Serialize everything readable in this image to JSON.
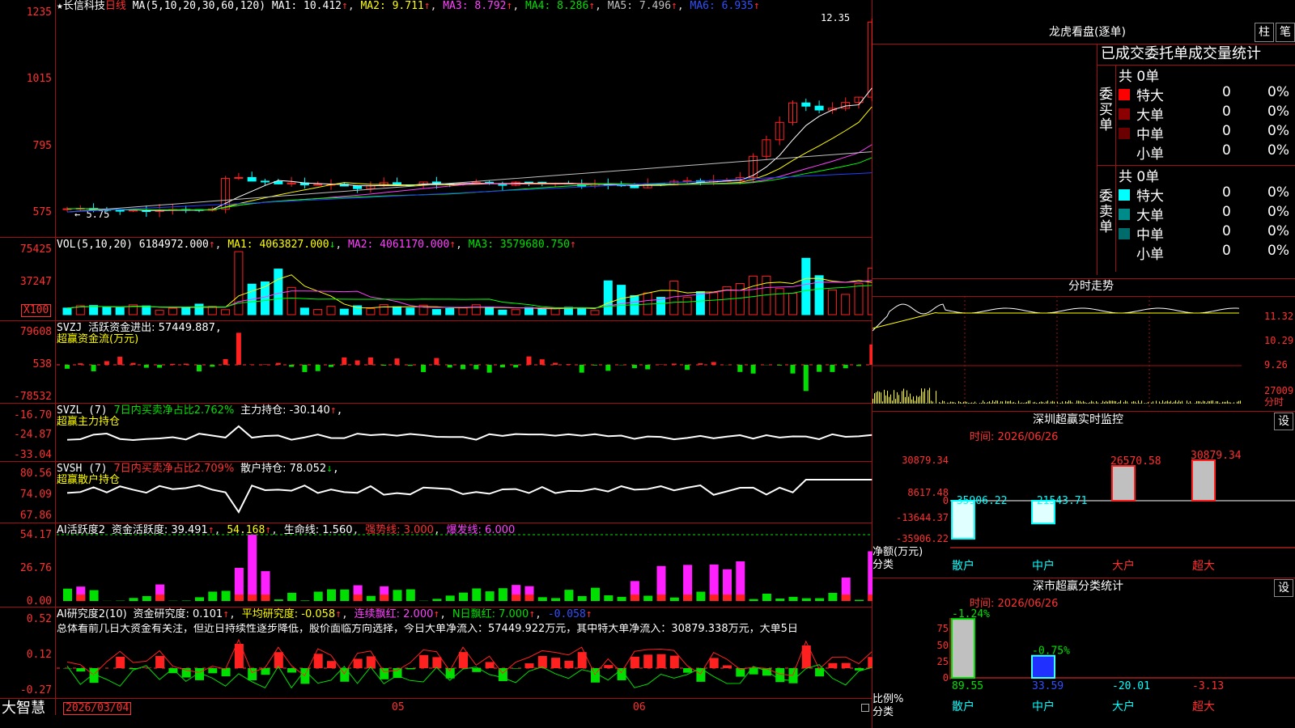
{
  "app_name": "大智慧",
  "stock": {
    "name": "长信科技",
    "period": "日线"
  },
  "colors": {
    "up": "#ff2020",
    "down": "#00ffff",
    "ma1": "#ffffff",
    "ma2": "#ffff00",
    "ma3": "#ff40ff",
    "ma4": "#00ff00",
    "ma5": "#c0c0c0",
    "ma6": "#2040ff"
  },
  "kline_panel": {
    "ma_label": "MA(5,10,20,30,60,120)",
    "ma1": "MA1: 10.412",
    "ma2": "MA2: 9.711",
    "ma3": "MA3: 8.792",
    "ma4": "MA4: 8.286",
    "ma5": "MA5: 7.496",
    "ma6": "MA6: 6.935",
    "y_ticks": [
      "1235",
      "1015",
      "795",
      "575"
    ],
    "high_label": "12.35",
    "low_label": "5.75"
  },
  "vol_panel": {
    "label": "VOL(5,10,20)",
    "value": "6184972.000",
    "ma1": "MA1: 4063827.000",
    "ma2": "MA2: 4061170.000",
    "ma3": "MA3: 3579680.750",
    "y_ticks": [
      "75425",
      "37247"
    ],
    "unit": "X100"
  },
  "svzj_panel": {
    "label": "SVZJ",
    "title": "活跃资金进出: 57449.887",
    "sub": "超赢资金流(万元)",
    "y_ticks": [
      "79608",
      "538",
      "-78532"
    ]
  },
  "svzl_panel": {
    "label": "SVZL (7)",
    "ratio": "7日内买卖净占比2.762%",
    "hold": "主力持仓: -30.140",
    "sub": "超赢主力持仓",
    "y_ticks": [
      "-16.70",
      "-24.87",
      "-33.04"
    ]
  },
  "svsh_panel": {
    "label": "SVSH (7)",
    "ratio": "7日内买卖净占比2.709%",
    "hold": "散户持仓: 78.052",
    "sub": "超赢散户持仓",
    "y_ticks": [
      "80.56",
      "74.09",
      "67.86"
    ]
  },
  "ai_act_panel": {
    "label": "AI活跃度2",
    "act": "资金活跃度: 39.491",
    "v2": "54.168",
    "life": "生命线: 1.560",
    "strong": "强势线: 3.000",
    "burst": "爆发线: 6.000",
    "y_ticks": [
      "54.17",
      "26.76",
      "0.00"
    ]
  },
  "ai_res_panel": {
    "label": "AI研究度2(10)",
    "res": "资金研究度: 0.101",
    "avg": "平均研究度: -0.058",
    "cont": "连续飘红: 2.000",
    "nday": "N日飘红: 7.000",
    "last": "-0.058",
    "summary": "总体看前几日大资金有关注，但近日持续性逐步降低，股价面临方向选择，今日大单净流入：57449.922万元，其中特大单净流入：30879.338万元，大单5日",
    "y_ticks": [
      "0.52",
      "0.12",
      "-0.27"
    ]
  },
  "time_axis": {
    "start": "2026/03/04",
    "m05": "05",
    "m06": "06"
  },
  "dragon_tiger": {
    "title": "龙虎看盘(逐单)",
    "tab1": "柱",
    "tab2": "笔",
    "header": "已成交委托单成交量统计",
    "buy_label": "委买单",
    "sell_label": "委卖单",
    "buy_total": "共 0单",
    "sell_total": "共 0单",
    "rows": [
      {
        "label": "特大",
        "v": "0",
        "p": "0%"
      },
      {
        "label": "大单",
        "v": "0",
        "p": "0%"
      },
      {
        "label": "中单",
        "v": "0",
        "p": "0%"
      },
      {
        "label": "小单",
        "v": "0",
        "p": "0%"
      }
    ],
    "buy_colors": [
      "#ff0000",
      "#8b0000",
      "#6b0000",
      "#000000"
    ],
    "sell_colors": [
      "#00ffff",
      "#008b8b",
      "#006b6b",
      "#000000"
    ]
  },
  "intraday": {
    "title": "分时走势",
    "y_ticks": [
      "11.32",
      "10.29",
      "9.26"
    ],
    "vol_tick": "27009",
    "unit": "分时"
  },
  "sz_monitor": {
    "title": "深圳超赢实时监控",
    "gear": "设",
    "time": "时间: 2026/06/26",
    "y_ticks": [
      "30879.34",
      "8617.48",
      "0",
      "-13644.37",
      "-35906.22"
    ],
    "ylabel": "净额(万元)",
    "xlabel": "分类",
    "chart_data": {
      "type": "bar",
      "categories": [
        "散户",
        "中户",
        "大户",
        "超大"
      ],
      "values": [
        -35906.22,
        -21543.71,
        26570.58,
        30879.34
      ],
      "value_labels": [
        "-35906.22",
        "-21543.71",
        "26570.58",
        "30879.34"
      ],
      "ylim": [
        -35906.22,
        30879.34
      ],
      "ylabel": "净额(万元)",
      "xlabel": "分类"
    }
  },
  "sz_class": {
    "title": "深市超赢分类统计",
    "gear": "设",
    "time": "时间: 2026/06/26",
    "y_ticks": [
      "75",
      "50",
      "25",
      "0"
    ],
    "ylabel": "比例%",
    "xlabel": "分类",
    "chart_data": {
      "type": "bar",
      "categories": [
        "散户",
        "中户",
        "大户",
        "超大"
      ],
      "bar_values": [
        89.55,
        33.59,
        0,
        0
      ],
      "bottom_labels": [
        "89.55",
        "33.59",
        "-20.01",
        "-3.13"
      ],
      "top_labels": [
        "-1.24%",
        "-0.75%",
        "",
        ""
      ],
      "ylim": [
        0,
        75
      ],
      "ylabel": "比例%",
      "xlabel": "分类"
    }
  }
}
